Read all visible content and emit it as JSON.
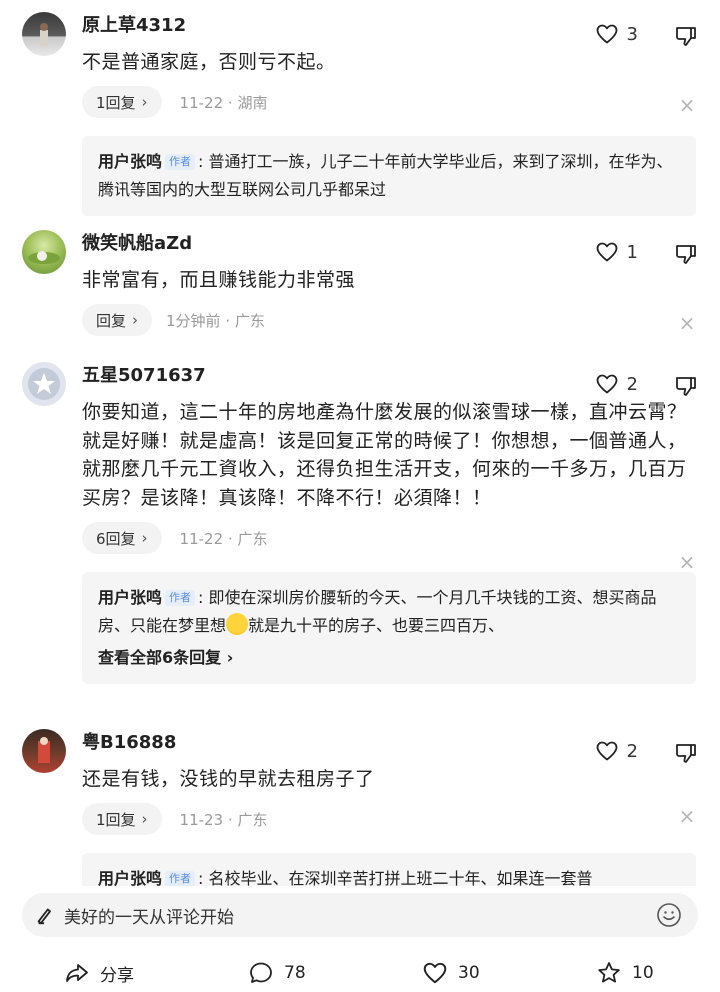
{
  "comments": [
    {
      "username": "原上草4312",
      "likes": "3",
      "text": "不是普通家庭，否则亏不起。",
      "reply_count_label": "1回复",
      "time_location": "11-22 · 湖南",
      "replies": [
        {
          "user": "用户张鸣",
          "tag": "作者",
          "text": ": 普通打工一族，儿子二十年前大学毕业后，来到了深圳，在华为、腾讯等国内的大型互联网公司几乎都呆过"
        }
      ]
    },
    {
      "username": "微笑帆船aZd",
      "likes": "1",
      "text": "非常富有，而且赚钱能力非常强",
      "reply_count_label": "回复",
      "time_location": "1分钟前 · 广东",
      "replies": []
    },
    {
      "username": "五星5071637",
      "likes": "2",
      "text": "你要知道，這二十年的房地產為什麼发展的似滚雪球一樣，直冲云霄？就是好赚！就是虛高！该是回复正常的時候了！你想想，一個普通人，就那麼几千元工資收入，还得负担生活开支，何來的一千多万，几百万买房？是该降！真该降！不降不行！必須降！！",
      "reply_count_label": "6回复",
      "time_location": "11-22 · 广东",
      "replies": [
        {
          "user": "用户张鸣",
          "tag": "作者",
          "text_before": ": 即使在深圳房价腰斩的今天、一个月几千块钱的工资、想买商品房、只能在梦里想",
          "text_after": "就是九十平的房子、也要三四百万、"
        }
      ],
      "view_all": "查看全部6条回复"
    },
    {
      "username": "粤B16888",
      "likes": "2",
      "text": "还是有钱，没钱的早就去租房子了",
      "reply_count_label": "1回复",
      "time_location": "11-23 · 广东",
      "replies": [
        {
          "user": "用户张鸣",
          "tag": "作者",
          "text": ": 名校毕业、在深圳辛苦打拼上班二十年、如果连一套普"
        }
      ]
    }
  ],
  "input": {
    "placeholder": "美好的一天从评论开始"
  },
  "bottom": {
    "share_label": "分享",
    "comments_count": "78",
    "likes_count": "30",
    "favorites_count": "10"
  },
  "icons": [
    "heart-icon",
    "dislike-icon",
    "close-icon",
    "pen-icon",
    "smile-icon",
    "share-icon",
    "comment-icon",
    "star-icon"
  ],
  "colors": {
    "author_tag": "#5a8ed8",
    "meta": "#9a9a9a",
    "reply_bg": "#f5f5f5"
  }
}
